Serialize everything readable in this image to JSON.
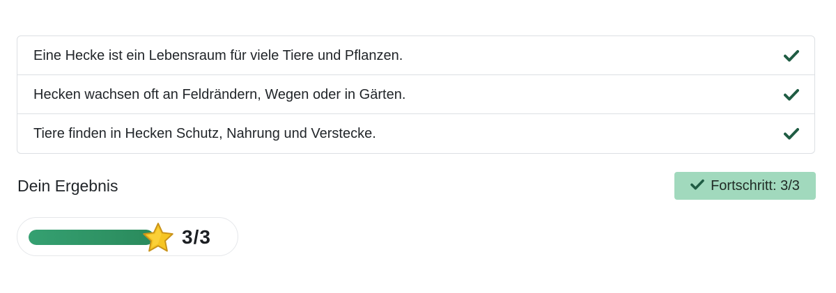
{
  "statements": [
    {
      "text": "Eine Hecke ist ein Lebensraum für viele Tiere und Pflanzen.",
      "status_icon": "check-icon"
    },
    {
      "text": "Hecken wachsen oft an Feldrändern, Wegen oder in Gärten.",
      "status_icon": "check-icon"
    },
    {
      "text": "Tiere finden in Hecken Schutz, Nahrung und Verstecke.",
      "status_icon": "check-icon"
    }
  ],
  "result": {
    "title": "Dein Ergebnis",
    "progress_badge": "Fortschritt: 3/3",
    "score_text": "3/3",
    "score_fraction": 1.0,
    "score_icon": "star-icon"
  },
  "colors": {
    "check": "#1f5c43",
    "badge_bg": "#a1d9bd",
    "bar_fill": "#2e9465",
    "star": "#f6c523"
  }
}
